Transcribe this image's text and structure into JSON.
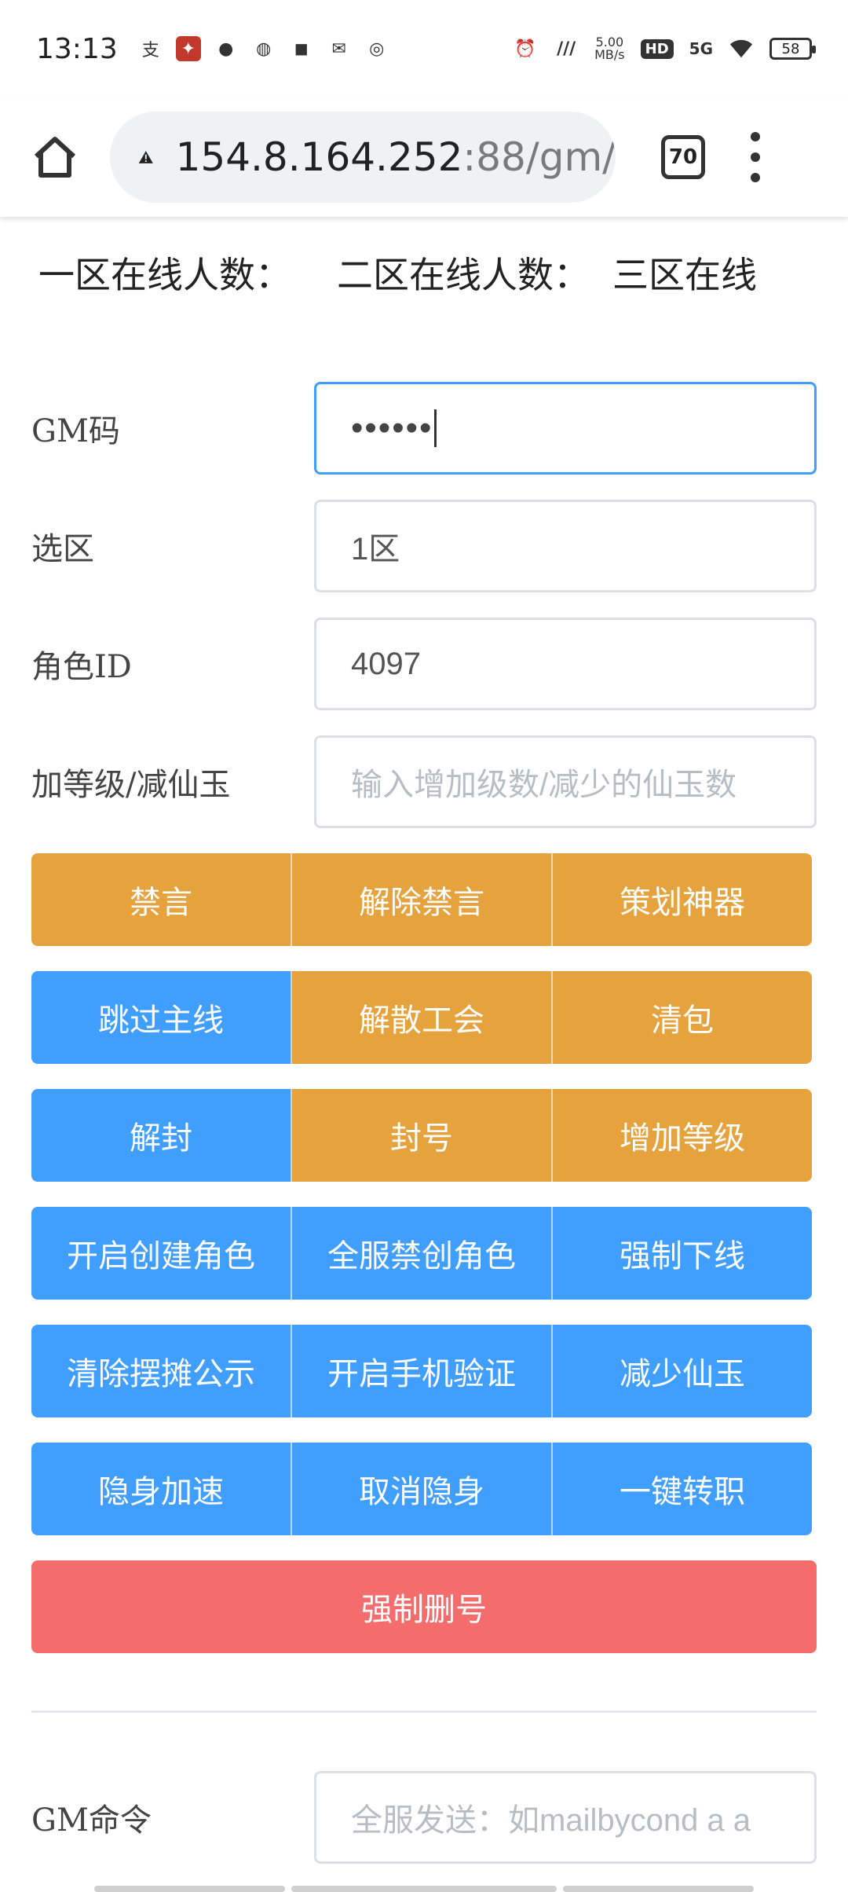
{
  "status_bar": {
    "time": "13:13",
    "net_speed_top": "5.00",
    "net_speed_bottom": "MB/s",
    "hd": "HD",
    "signal": "5G",
    "battery": "58",
    "icons": [
      "alipay-icon",
      "game-icon",
      "qq-icon",
      "wechat-icon",
      "chat-icon",
      "mail-icon",
      "browser-icon",
      "alarm-icon",
      "nfc-icon",
      "wifi-icon"
    ]
  },
  "browser": {
    "url_host": "154.8.164.252",
    "url_rest": ":88/gm/",
    "tab_count": "70"
  },
  "online": {
    "zone1": "一区在线人数：",
    "zone2": "二区在线人数：",
    "zone3": "三区在线"
  },
  "form": {
    "gm_code_label": "GM码",
    "gm_code_value": "••••••",
    "zone_label": "选区",
    "zone_value": "1区",
    "role_id_label": "角色ID",
    "role_id_value": "4097",
    "level_label": "加等级/减仙玉",
    "level_placeholder": "输入增加级数/减少的仙玉数",
    "gm_cmd_label": "GM命令",
    "gm_cmd_placeholder": "全服发送：如mailbycond a a"
  },
  "buttons": {
    "row1": [
      "禁言",
      "解除禁言",
      "策划神器"
    ],
    "row2": [
      "跳过主线",
      "解散工会",
      "清包"
    ],
    "row3": [
      "解封",
      "封号",
      "增加等级"
    ],
    "row4": [
      "开启创建角色",
      "全服禁创角色",
      "强制下线"
    ],
    "row5": [
      "清除摆摊公示",
      "开启手机验证",
      "减少仙玉"
    ],
    "row6": [
      "隐身加速",
      "取消隐身",
      "一键转职"
    ],
    "delete": "强制删号"
  },
  "colors": {
    "orange": "#e6a23c",
    "blue": "#409eff",
    "red": "#f56c6c"
  }
}
